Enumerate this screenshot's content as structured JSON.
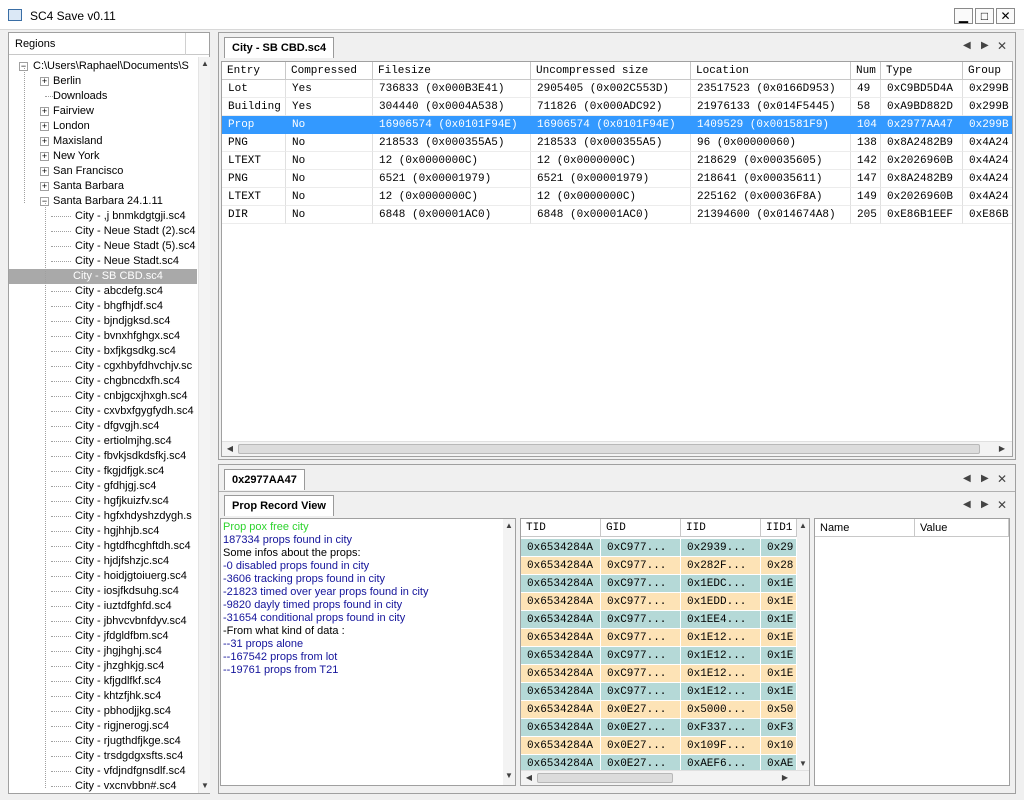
{
  "window": {
    "title": "SC4 Save v0.11",
    "min": "▁",
    "max": "□",
    "close": "✕"
  },
  "regions": {
    "header": "Regions",
    "root": "C:\\Users\\Raphael\\Documents\\S",
    "folders": [
      "Berlin",
      "Downloads",
      "Fairview",
      "London",
      "Maxisland",
      "New York",
      "San Francisco",
      "Santa Barbara",
      "Santa Barbara 24.1.11"
    ],
    "files": [
      "City - ,j bnmkdgtgji.sc4",
      "City - Neue Stadt (2).sc4",
      "City - Neue Stadt (5).sc4",
      "City - Neue Stadt.sc4",
      "City - SB CBD.sc4",
      "City - abcdefg.sc4",
      "City - bhgfhjdf.sc4",
      "City - bjndjgksd.sc4",
      "City - bvnxhfghgx.sc4",
      "City - bxfjkgsdkg.sc4",
      "City - cgxhbyfdhvchjv.sc",
      "City - chgbncdxfh.sc4",
      "City - cnbjgcxjhxgh.sc4",
      "City - cxvbxfgygfydh.sc4",
      "City - dfgvgjh.sc4",
      "City - ertiolmjhg.sc4",
      "City - fbvkjsdkdsfkj.sc4",
      "City - fkgjdfjgk.sc4",
      "City - gfdhjgj.sc4",
      "City - hgfjkuizfv.sc4",
      "City - hgfxhdyshzdygh.s",
      "City - hgjhhjb.sc4",
      "City - hgtdfhcghftdh.sc4",
      "City - hjdjfshzjc.sc4",
      "City - hoidjgtoiuerg.sc4",
      "City - iosjfkdsuhg.sc4",
      "City - iuztdfghfd.sc4",
      "City - jbhvcvbnfdyv.sc4",
      "City - jfdgldfbm.sc4",
      "City - jhgjhghj.sc4",
      "City - jhzghkjg.sc4",
      "City - kfjgdlfkf.sc4",
      "City - khtzfjhk.sc4",
      "City - pbhodjjkg.sc4",
      "City - rigjnerogj.sc4",
      "City - rjugthdfjkge.sc4",
      "City - trsdgdgxsfts.sc4",
      "City - vfdjndfgnsdlf.sc4",
      "City - vxcnvbbn#.sc4"
    ]
  },
  "top_pane": {
    "tab": "City - SB CBD.sc4",
    "columns": [
      "Entry",
      "Compressed",
      "Filesize",
      "Uncompressed size",
      "Location",
      "Num",
      "Type",
      "Group"
    ],
    "rows": [
      [
        "Lot",
        "Yes",
        "736833 (0x000B3E41)",
        "2905405 (0x002C553D)",
        "23517523 (0x0166D953)",
        "49",
        "0xC9BD5D4A",
        "0x299B"
      ],
      [
        "Building",
        "Yes",
        "304440 (0x0004A538)",
        "711826 (0x000ADC92)",
        "21976133 (0x014F5445)",
        "58",
        "0xA9BD882D",
        "0x299B"
      ],
      [
        "Prop",
        "No",
        "16906574 (0x0101F94E)",
        "16906574 (0x0101F94E)",
        "1409529 (0x001581F9)",
        "104",
        "0x2977AA47",
        "0x299B"
      ],
      [
        "PNG",
        "No",
        "218533 (0x000355A5)",
        "218533 (0x000355A5)",
        "96 (0x00000060)",
        "138",
        "0x8A2482B9",
        "0x4A24"
      ],
      [
        "LTEXT",
        "No",
        "12 (0x0000000C)",
        "12 (0x0000000C)",
        "218629 (0x00035605)",
        "142",
        "0x2026960B",
        "0x4A24"
      ],
      [
        "PNG",
        "No",
        "6521 (0x00001979)",
        "6521 (0x00001979)",
        "218641 (0x00035611)",
        "147",
        "0x8A2482B9",
        "0x4A24"
      ],
      [
        "LTEXT",
        "No",
        "12 (0x0000000C)",
        "12 (0x0000000C)",
        "225162 (0x00036F8A)",
        "149",
        "0x2026960B",
        "0x4A24"
      ],
      [
        "DIR",
        "No",
        "6848 (0x00001AC0)",
        "6848 (0x00001AC0)",
        "21394600 (0x014674A8)",
        "205",
        "0xE86B1EEF",
        "0xE86B"
      ]
    ],
    "selected_row": 2
  },
  "bottom_pane": {
    "outer_tab": "0x2977AA47",
    "inner_tab": "Prop Record View",
    "info_lines": [
      {
        "text": "Prop pox free city",
        "color": "#2ed32e"
      },
      {
        "text": "187334 props found in city",
        "color": "#14149b"
      },
      {
        "text": "Some infos about the props:",
        "color": "#000000"
      },
      {
        "text": "-0 disabled props found in city",
        "color": "#14149b"
      },
      {
        "text": "-3606 tracking props found in city",
        "color": "#14149b"
      },
      {
        "text": "-21823 timed over year props found in city",
        "color": "#14149b"
      },
      {
        "text": "-9820 dayly timed props found in city",
        "color": "#14149b"
      },
      {
        "text": "-31654 conditional props found in city",
        "color": "#14149b"
      },
      {
        "text": "-From what kind of data :",
        "color": "#000000"
      },
      {
        "text": "--31 props alone",
        "color": "#14149b"
      },
      {
        "text": "--167542 props from lot",
        "color": "#14149b"
      },
      {
        "text": "--19761 props from T21",
        "color": "#14149b"
      }
    ],
    "record_columns": [
      "TID",
      "GID",
      "IID",
      "IID1"
    ],
    "records": [
      {
        "cells": [
          "0x6534284A",
          "0xC977...",
          "0x2939...",
          "0x29"
        ],
        "tone": "teal"
      },
      {
        "cells": [
          "0x6534284A",
          "0xC977...",
          "0x282F...",
          "0x28"
        ],
        "tone": "orange"
      },
      {
        "cells": [
          "0x6534284A",
          "0xC977...",
          "0x1EDC...",
          "0x1E"
        ],
        "tone": "teal"
      },
      {
        "cells": [
          "0x6534284A",
          "0xC977...",
          "0x1EDD...",
          "0x1E"
        ],
        "tone": "orange"
      },
      {
        "cells": [
          "0x6534284A",
          "0xC977...",
          "0x1EE4...",
          "0x1E"
        ],
        "tone": "teal"
      },
      {
        "cells": [
          "0x6534284A",
          "0xC977...",
          "0x1E12...",
          "0x1E"
        ],
        "tone": "orange"
      },
      {
        "cells": [
          "0x6534284A",
          "0xC977...",
          "0x1E12...",
          "0x1E"
        ],
        "tone": "teal"
      },
      {
        "cells": [
          "0x6534284A",
          "0xC977...",
          "0x1E12...",
          "0x1E"
        ],
        "tone": "orange"
      },
      {
        "cells": [
          "0x6534284A",
          "0xC977...",
          "0x1E12...",
          "0x1E"
        ],
        "tone": "teal"
      },
      {
        "cells": [
          "0x6534284A",
          "0x0E27...",
          "0x5000...",
          "0x50"
        ],
        "tone": "orange"
      },
      {
        "cells": [
          "0x6534284A",
          "0x0E27...",
          "0xF337...",
          "0xF3"
        ],
        "tone": "teal"
      },
      {
        "cells": [
          "0x6534284A",
          "0x0E27...",
          "0x109F...",
          "0x10"
        ],
        "tone": "orange"
      },
      {
        "cells": [
          "0x6534284A",
          "0x0E27...",
          "0xAEF6...",
          "0xAE"
        ],
        "tone": "teal"
      }
    ],
    "props_columns": [
      "Name",
      "Value"
    ]
  },
  "colors": {
    "selection": "#3399ff",
    "tree_selection": "#a9a9a9",
    "row_teal": "#b5d9d7",
    "row_orange": "#fde3b6"
  }
}
